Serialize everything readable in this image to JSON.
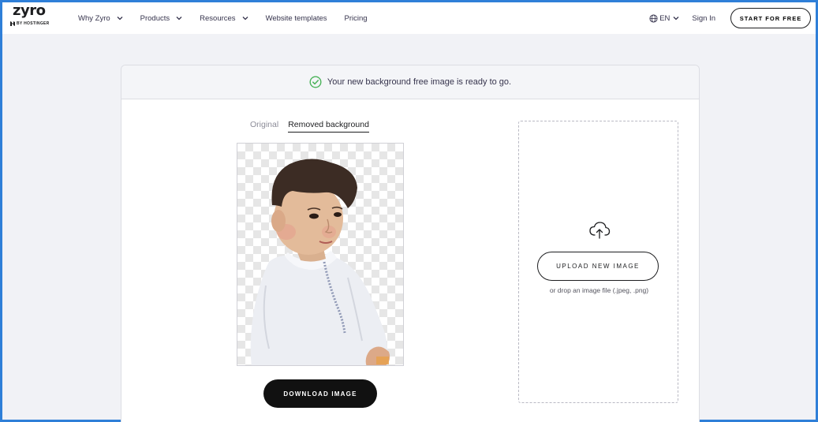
{
  "header": {
    "logo_text": "zyro",
    "logo_sub": "BY HOSTINGER",
    "nav": [
      {
        "label": "Why Zyro",
        "dropdown": true
      },
      {
        "label": "Products",
        "dropdown": true
      },
      {
        "label": "Resources",
        "dropdown": true
      },
      {
        "label": "Website templates",
        "dropdown": false
      },
      {
        "label": "Pricing",
        "dropdown": false
      }
    ],
    "language": "EN",
    "sign_in": "Sign In",
    "start_button": "START FOR FREE"
  },
  "banner": {
    "message": "Your new background free image is ready to go.",
    "icon": "check-circle-icon",
    "icon_color": "#4bb35a"
  },
  "tabs": [
    {
      "label": "Original",
      "active": false
    },
    {
      "label": "Removed background",
      "active": true
    }
  ],
  "preview": {
    "description_icon": "child-portrait-image"
  },
  "download_button": "DOWNLOAD IMAGE",
  "upload": {
    "button": "UPLOAD NEW IMAGE",
    "hint": "or drop an image file (.jpeg, .png)",
    "icon": "cloud-upload-icon"
  },
  "colors": {
    "frame_border": "#2f7fd8",
    "page_background": "#f1f2f6",
    "primary_dark": "#111111"
  }
}
